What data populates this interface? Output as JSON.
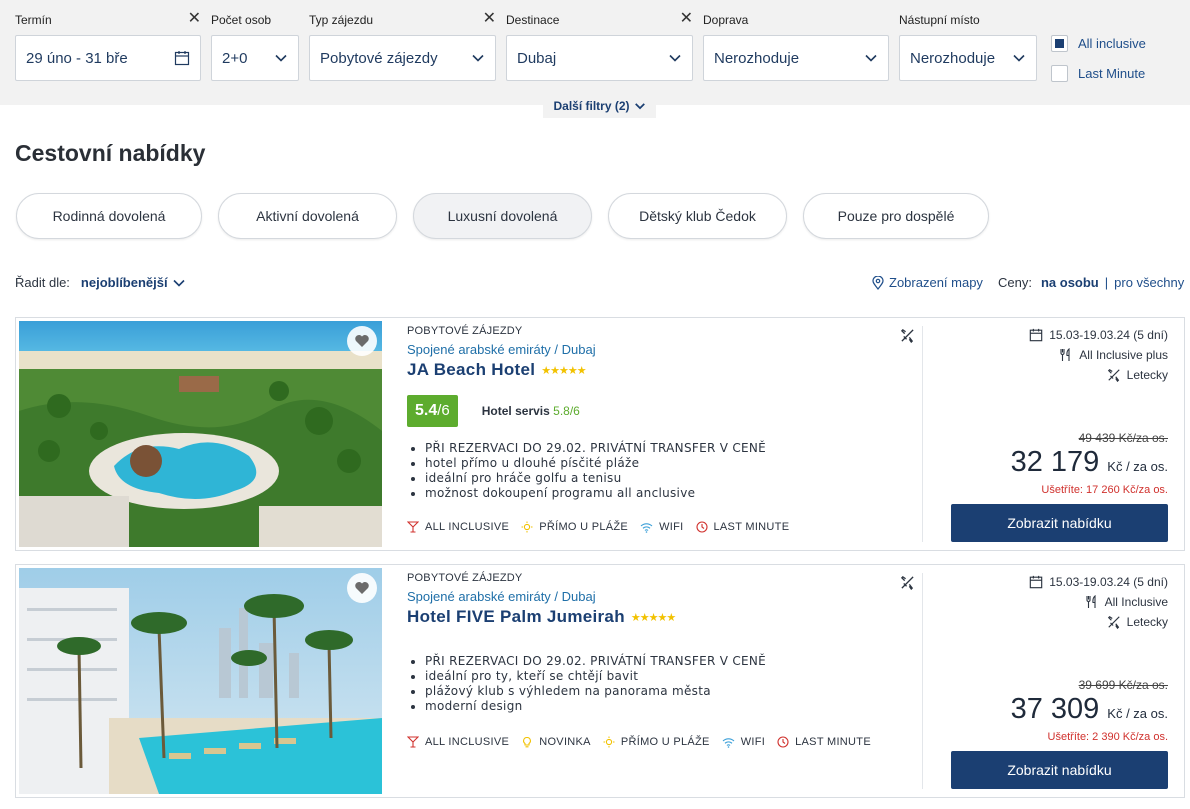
{
  "filters": [
    {
      "label": "Termín",
      "value": "29 úno - 31 bře",
      "clearable": true,
      "icon": "calendar-icon"
    },
    {
      "label": "Počet osob",
      "value": "2+0",
      "clearable": false,
      "icon": "chevron-down-icon"
    },
    {
      "label": "Typ zájezdu",
      "value": "Pobytové zájezdy",
      "clearable": true,
      "icon": "chevron-down-icon"
    },
    {
      "label": "Destinace",
      "value": "Dubaj",
      "clearable": true,
      "icon": "chevron-down-icon"
    },
    {
      "label": "Doprava",
      "value": "Nerozhoduje",
      "clearable": false,
      "icon": "chevron-down-icon"
    },
    {
      "label": "Nástupní místo",
      "value": "Nerozhoduje",
      "clearable": false,
      "icon": "chevron-down-icon"
    }
  ],
  "clear_symbol": "✕",
  "checkboxes": [
    {
      "label": "All inclusive",
      "checked": true
    },
    {
      "label": "Last Minute",
      "checked": false
    }
  ],
  "more_filters": "Další filtry (2)",
  "page_title": "Cestovní nabídky",
  "chips": [
    {
      "label": "Rodinná dovolená",
      "active": false
    },
    {
      "label": "Aktivní dovolená",
      "active": false
    },
    {
      "label": "Luxusní dovolená",
      "active": true
    },
    {
      "label": "Dětský klub Čedok",
      "active": false
    },
    {
      "label": "Pouze pro dospělé",
      "active": false
    }
  ],
  "sort": {
    "label": "Řadit dle:",
    "value": "nejoblíbenější"
  },
  "map_link": "Zobrazení mapy",
  "prices_toggle": {
    "label": "Ceny:",
    "active": "na osobu",
    "separator": "|",
    "other": "pro všechny"
  },
  "offers": [
    {
      "type": "POBYTOVÉ ZÁJEZDY",
      "location": "Spojené arabské emiráty / Dubaj",
      "name": "JA Beach Hotel",
      "stars": "★★★★★",
      "rating": {
        "score": "5.4",
        "max": "/6",
        "service_label": "Hotel servis",
        "service_value": "5.8/6"
      },
      "bullets": [
        "PŘI REZERVACI DO 29.02. PRIVÁTNÍ TRANSFER V CENĚ",
        "hotel přímo u dlouhé písčité pláže",
        "ideální pro hráče golfu a tenisu",
        "možnost dokoupení programu all anclusive"
      ],
      "amenities": [
        {
          "icon": "cocktail-icon",
          "label": "ALL INCLUSIVE"
        },
        {
          "icon": "sun-icon",
          "label": "PŘÍMO U PLÁŽE"
        },
        {
          "icon": "wifi-icon",
          "label": "WIFI"
        },
        {
          "icon": "clock-icon",
          "label": "LAST MINUTE"
        }
      ],
      "dates": "15.03-19.03.24 (5 dní)",
      "board": "All Inclusive plus",
      "transport": "Letecky",
      "old_price": "49 439 Kč/za os.",
      "price": "32 179",
      "price_unit": "Kč / za os.",
      "save": "Ušetříte: 17 260 Kč/za os.",
      "button": "Zobrazit nabídku"
    },
    {
      "type": "POBYTOVÉ ZÁJEZDY",
      "location": "Spojené arabské emiráty / Dubaj",
      "name": "Hotel FIVE Palm Jumeirah",
      "stars": "★★★★★",
      "bullets": [
        "PŘI REZERVACI DO 29.02. PRIVÁTNÍ TRANSFER V CENĚ",
        "ideální pro ty, kteří se chtějí bavit",
        "plážový klub s výhledem na panorama města",
        "moderní design"
      ],
      "amenities": [
        {
          "icon": "cocktail-icon",
          "label": "ALL INCLUSIVE"
        },
        {
          "icon": "lightbulb-icon",
          "label": "NOVINKA"
        },
        {
          "icon": "sun-icon",
          "label": "PŘÍMO U PLÁŽE"
        },
        {
          "icon": "wifi-icon",
          "label": "WIFI"
        },
        {
          "icon": "clock-icon",
          "label": "LAST MINUTE"
        }
      ],
      "dates": "15.03-19.03.24 (5 dní)",
      "board": "All Inclusive",
      "transport": "Letecky",
      "old_price": "39 699 Kč/za os.",
      "price": "37 309",
      "price_unit": "Kč / za os.",
      "save": "Ušetříte: 2 390 Kč/za os.",
      "button": "Zobrazit nabídku"
    }
  ],
  "colors": {
    "primary": "#1b3f72",
    "link": "#1f6fa8",
    "rating_green": "#5dac2e",
    "save_red": "#d0312d",
    "star_yellow": "#f2c200",
    "filter_bg": "#f2f2f2"
  }
}
